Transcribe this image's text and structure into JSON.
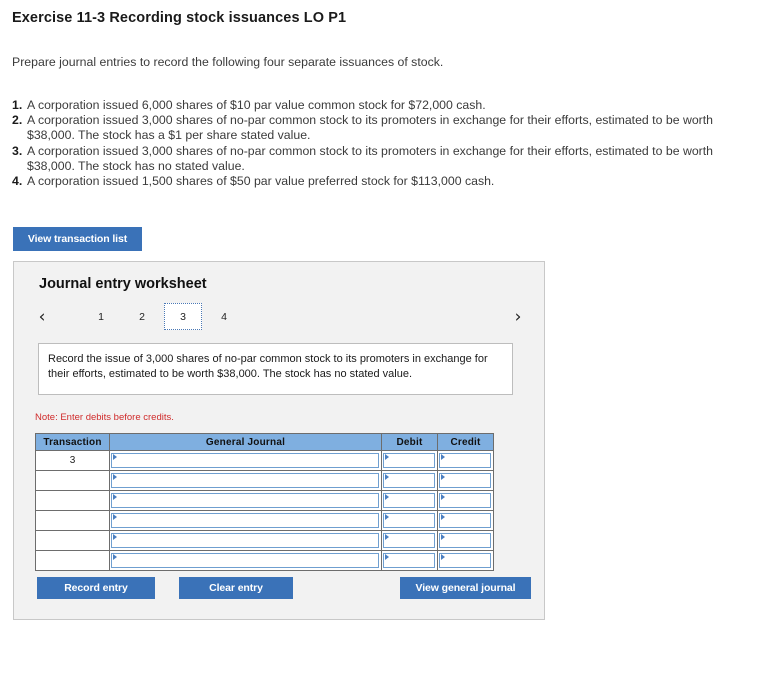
{
  "exercise": {
    "title": "Exercise 11-3 Recording stock issuances LO P1",
    "prepare_line": "Prepare journal entries to record the following four separate issuances of stock.",
    "requirements": [
      {
        "num": "1.",
        "text": "A corporation issued 6,000 shares of $10 par value common stock for $72,000 cash."
      },
      {
        "num": "2.",
        "text": "A corporation issued 3,000 shares of no-par common stock to its promoters in exchange for their efforts, estimated to be worth $38,000. The stock has a $1 per share stated value."
      },
      {
        "num": "3.",
        "text": "A corporation issued 3,000 shares of no-par common stock to its promoters in exchange for their efforts, estimated to be worth $38,000. The stock has no stated value."
      },
      {
        "num": "4.",
        "text": "A corporation issued 1,500 shares of $50 par value preferred stock for $113,000 cash."
      }
    ]
  },
  "toolbar": {
    "view_transaction_list_label": "View transaction list"
  },
  "worksheet": {
    "title": "Journal entry worksheet",
    "nav": {
      "prev_icon": "‹",
      "next_icon": "›"
    },
    "tabs": [
      {
        "label": "1",
        "selected": false
      },
      {
        "label": "2",
        "selected": false
      },
      {
        "label": "3",
        "selected": true
      },
      {
        "label": "4",
        "selected": false
      }
    ],
    "instruction": "Record the issue of 3,000 shares of no-par common stock to its promoters in exchange for their efforts, estimated to be worth $38,000. The stock has no stated value.",
    "note": "Note: Enter debits before credits.",
    "table": {
      "headers": [
        "Transaction",
        "General Journal",
        "Debit",
        "Credit"
      ],
      "rows": [
        {
          "transaction": "3",
          "general_journal": "",
          "debit": "",
          "credit": ""
        },
        {
          "transaction": "",
          "general_journal": "",
          "debit": "",
          "credit": ""
        },
        {
          "transaction": "",
          "general_journal": "",
          "debit": "",
          "credit": ""
        },
        {
          "transaction": "",
          "general_journal": "",
          "debit": "",
          "credit": ""
        },
        {
          "transaction": "",
          "general_journal": "",
          "debit": "",
          "credit": ""
        },
        {
          "transaction": "",
          "general_journal": "",
          "debit": "",
          "credit": ""
        }
      ]
    },
    "actions": {
      "record_entry_label": "Record entry",
      "clear_entry_label": "Clear entry",
      "view_general_journal_label": "View general journal"
    }
  },
  "colors": {
    "button_blue": "#3a72b8",
    "table_header_blue": "#7fafe0",
    "panel_gray": "#f2f2f2",
    "note_red": "#d02b2b",
    "field_border_blue": "#6f9fd0"
  }
}
